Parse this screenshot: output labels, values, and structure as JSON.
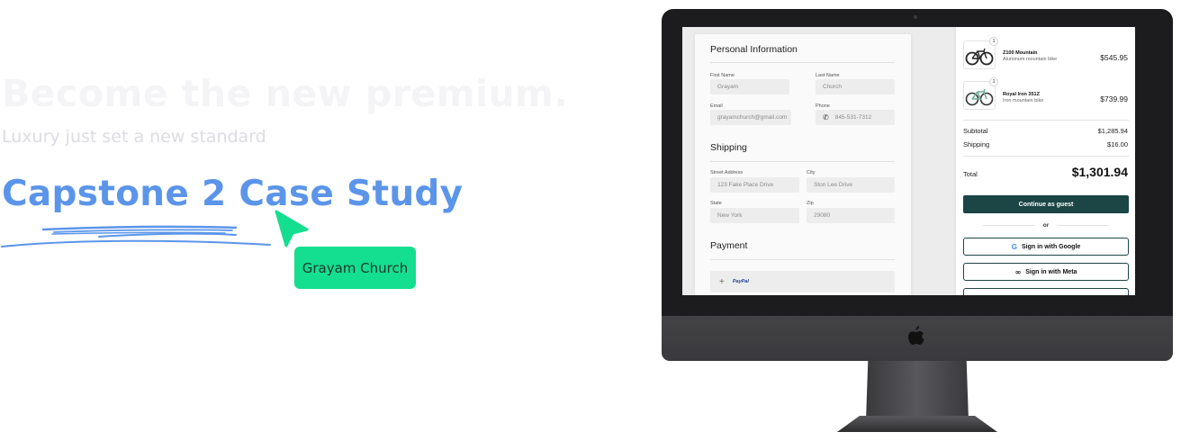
{
  "hero": {
    "headline": "Become the new premium.",
    "subline": "Luxury just set a new standard",
    "case_title": "Capstone 2 Case Study",
    "name_tag": "Grayam Church"
  },
  "checkout": {
    "personal": {
      "title": "Personal Information",
      "first_name_label": "First Name",
      "first_name_value": "Grayam",
      "last_name_label": "Last Name",
      "last_name_value": "Church",
      "email_label": "Email",
      "email_value": "grayamchurch@gmail.com",
      "phone_label": "Phone",
      "phone_value": "845-531-7312"
    },
    "shipping": {
      "title": "Shipping",
      "street_label": "Street Address",
      "street_value": "123 Fake Place Drive",
      "city_label": "City",
      "city_value": "Ston Lee Drive",
      "state_label": "State",
      "state_value": "New York",
      "zip_label": "Zip",
      "zip_value": "29080"
    },
    "payment": {
      "title": "Payment",
      "plus": "+",
      "paypal": "PayPal"
    }
  },
  "order": {
    "items": [
      {
        "qty": "1",
        "name": "Z100 Mountain",
        "desc": "Aluminum mountain bike",
        "price": "$545.95",
        "color": "#222222"
      },
      {
        "qty": "1",
        "name": "Royal Iron 351Z",
        "desc": "Iron mountain bike",
        "price": "$739.99",
        "color": "#6fae9a"
      }
    ],
    "subtotal_label": "Subtotal",
    "subtotal_value": "$1,285.94",
    "shipping_label": "Shipping",
    "shipping_value": "$16.00",
    "total_label": "Total",
    "total_value": "$1,301.94",
    "guest_button": "Continue as guest",
    "or_text": "or",
    "google_icon": "G",
    "google_button": "Sign in with Google",
    "meta_icon": "∞",
    "meta_button": "Sign in with Meta"
  },
  "colors": {
    "accent_blue": "#5b95e9",
    "tag_green": "#14de8f",
    "button_teal": "#1c4545"
  },
  "icons": {
    "cursor": "cursor-arrow-icon",
    "apple": "apple-logo-icon",
    "phone": "phone-icon",
    "bike": "bicycle-icon"
  }
}
